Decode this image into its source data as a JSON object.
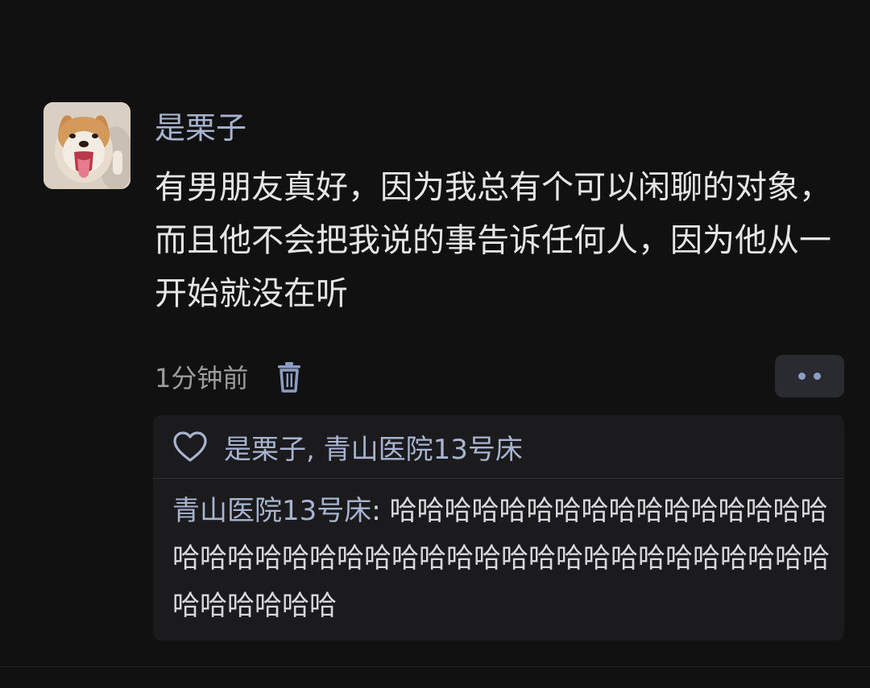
{
  "post": {
    "username": "是栗子",
    "content": "有男朋友真好，因为我总有个可以闲聊的对象，而且他不会把我说的事告诉任何人，因为他从一开始就没在听",
    "time": "1分钟前",
    "delete_icon": "trash-icon",
    "more_icon": "more-dots-icon"
  },
  "interactions": {
    "like_icon": "heart-outline-icon",
    "likers": "是栗子, 青山医院13号床",
    "comments": [
      {
        "author": "青山医院13号床",
        "separator": ": ",
        "text": "哈哈哈哈哈哈哈哈哈哈哈哈哈哈哈哈哈哈哈哈哈哈哈哈哈哈哈哈哈哈哈哈哈哈哈哈哈哈哈哈哈哈哈哈哈哈"
      }
    ]
  },
  "colors": {
    "background": "#111111",
    "name": "#a8b4cf",
    "text": "#e6e6e6",
    "muted": "#9c9c9c",
    "panel": "#1b1b1d"
  }
}
